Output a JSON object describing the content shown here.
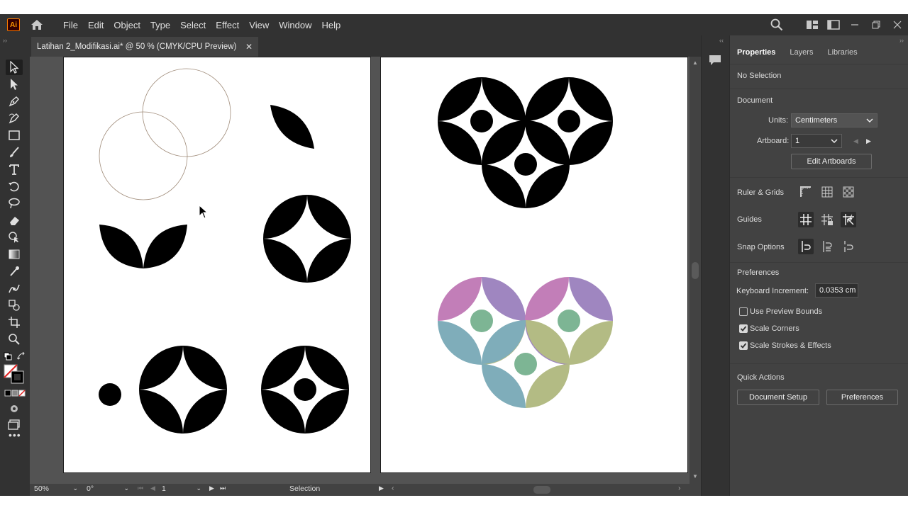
{
  "app": {
    "logo_text": "Ai"
  },
  "menu": {
    "items": [
      "File",
      "Edit",
      "Object",
      "Type",
      "Select",
      "Effect",
      "View",
      "Window",
      "Help"
    ]
  },
  "document_tab": {
    "title": "Latihan 2_Modifikasi.ai* @ 50 % (CMYK/CPU Preview)",
    "close_glyph": "✕"
  },
  "status": {
    "zoom": "50%",
    "rotation": "0°",
    "artboard_number": "1",
    "tool_name": "Selection"
  },
  "panel": {
    "tabs": [
      "Properties",
      "Layers",
      "Libraries"
    ],
    "selection_state": "No Selection",
    "document_heading": "Document",
    "units_label": "Units:",
    "units_value": "Centimeters",
    "artboard_label": "Artboard:",
    "artboard_value": "1",
    "edit_artboards": "Edit Artboards",
    "ruler_grids": "Ruler & Grids",
    "guides": "Guides",
    "snap_options": "Snap Options",
    "preferences_heading": "Preferences",
    "keyboard_increment_label": "Keyboard Increment:",
    "keyboard_increment_value": "0.0353 cm",
    "checkboxes": [
      {
        "label": "Use Preview Bounds",
        "checked": false
      },
      {
        "label": "Scale Corners",
        "checked": true
      },
      {
        "label": "Scale Strokes & Effects",
        "checked": true
      }
    ],
    "quick_actions": "Quick Actions",
    "document_setup_button": "Document Setup",
    "preferences_button": "Preferences"
  },
  "colors": {
    "ui_dark": "#323232",
    "ui_mid": "#424242",
    "canvas_bg": "#535353",
    "pattern_pink": "#c27eb8",
    "pattern_purple": "#9f86c0",
    "pattern_teal": "#7fadba",
    "pattern_olive": "#b3bb84",
    "pattern_green": "#7db594"
  }
}
